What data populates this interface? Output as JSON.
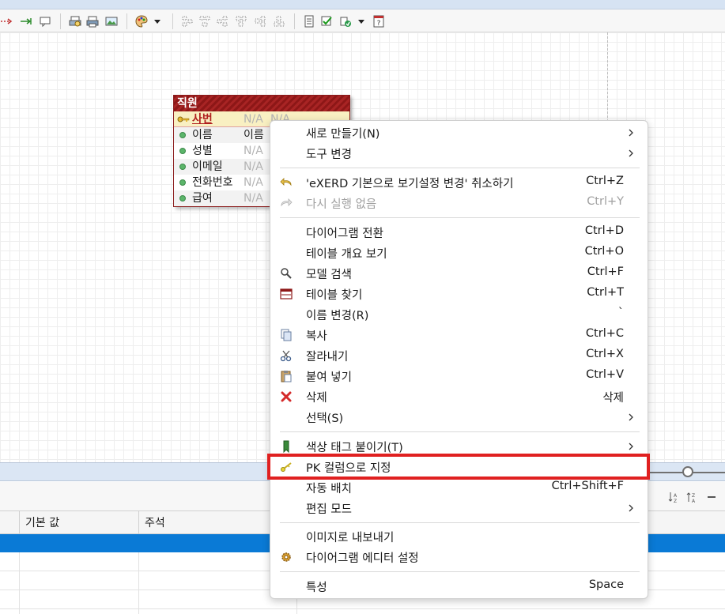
{
  "entity": {
    "title": "직원",
    "columns": [
      {
        "name": "사번",
        "logical": "N/A",
        "type": "N/A",
        "pk": true
      },
      {
        "name": "이름",
        "logical": "이름",
        "type": "",
        "pk": false
      },
      {
        "name": "성별",
        "logical": "N/A",
        "type": "",
        "pk": false
      },
      {
        "name": "이메일",
        "logical": "N/A",
        "type": "",
        "pk": false
      },
      {
        "name": "전화번호",
        "logical": "N/A",
        "type": "",
        "pk": false
      },
      {
        "name": "급여",
        "logical": "N/A",
        "type": "",
        "pk": false
      }
    ]
  },
  "grid": {
    "headers": [
      "기본 값",
      "주석"
    ]
  },
  "menu": {
    "items": [
      {
        "label": "새로 만들기(N)",
        "shortcut": "",
        "submenu": true,
        "icon": ""
      },
      {
        "label": "도구 변경",
        "shortcut": "",
        "submenu": true,
        "icon": ""
      },
      {
        "label": "'eXERD 기본으로 보기설정 변경' 취소하기",
        "shortcut": "Ctrl+Z",
        "icon": "undo-icon"
      },
      {
        "label": "다시 실행 없음",
        "shortcut": "Ctrl+Y",
        "icon": "redo-icon",
        "disabled": true
      },
      {
        "label": "다이어그램 전환",
        "shortcut": "Ctrl+D",
        "icon": ""
      },
      {
        "label": "테이블 개요 보기",
        "shortcut": "Ctrl+O",
        "icon": ""
      },
      {
        "label": "모델 검색",
        "shortcut": "Ctrl+F",
        "icon": "search-icon"
      },
      {
        "label": "테이블 찾기",
        "shortcut": "Ctrl+T",
        "icon": "table-icon"
      },
      {
        "label": "이름 변경(R)",
        "shortcut": "`",
        "icon": ""
      },
      {
        "label": "복사",
        "shortcut": "Ctrl+C",
        "icon": "copy-icon"
      },
      {
        "label": "잘라내기",
        "shortcut": "Ctrl+X",
        "icon": "scissors-icon"
      },
      {
        "label": "붙여 넣기",
        "shortcut": "Ctrl+V",
        "icon": "paste-icon"
      },
      {
        "label": "삭제",
        "shortcut": "삭제",
        "icon": "delete-icon"
      },
      {
        "label": "선택(S)",
        "shortcut": "",
        "submenu": true,
        "icon": ""
      },
      {
        "label": "색상 태그 붙이기(T)",
        "shortcut": "",
        "submenu": true,
        "icon": "bookmark-icon"
      },
      {
        "label": "PK 컬럼으로 지정",
        "shortcut": "",
        "icon": "key-icon",
        "highlighted": true
      },
      {
        "label": "자동 배치",
        "shortcut": "Ctrl+Shift+F",
        "icon": ""
      },
      {
        "label": "편집 모드",
        "shortcut": "",
        "submenu": true,
        "icon": ""
      },
      {
        "label": "이미지로 내보내기",
        "shortcut": "",
        "icon": ""
      },
      {
        "label": "다이어그램 에디터 설정",
        "shortcut": "",
        "icon": "gear-icon"
      },
      {
        "label": "특성",
        "shortcut": "Space",
        "icon": ""
      }
    ]
  },
  "colors": {
    "entity_header": "#8d1717",
    "highlight_box": "#e02020",
    "selected_row": "#0a7ad6"
  }
}
